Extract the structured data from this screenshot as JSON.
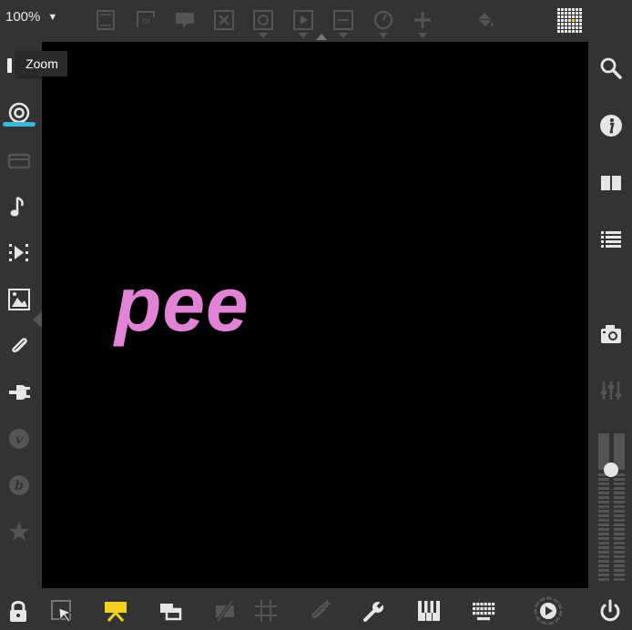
{
  "topbar": {
    "zoom_value": "100%",
    "zoom_arrow": "▼",
    "icons": [
      "frame-icon",
      "text-box-icon",
      "comment-icon",
      "close-box-icon",
      "record-box-icon",
      "play-box-icon",
      "minus-box-icon",
      "gauge-icon",
      "plus-icon",
      "paint-bucket-icon",
      "pixel-grid-icon"
    ]
  },
  "tooltip": {
    "label": "Zoom"
  },
  "stage": {
    "text": "pee",
    "text_color": "#e282d6",
    "background": "#000000"
  },
  "left_sidebar": {
    "icons": [
      "webcam-icon",
      "tray-icon",
      "music-note-icon",
      "skip-forward-icon",
      "image-icon",
      "paperclip-icon",
      "plug-icon",
      "vimeo-icon",
      "bandcamp-icon",
      "star-icon"
    ],
    "active_color": "#39b8d8"
  },
  "right_sidebar": {
    "icons": [
      "search-icon",
      "info-icon",
      "book-icon",
      "list-icon",
      "camera-icon",
      "sliders-icon"
    ],
    "volume_level": 0.8
  },
  "bottom_bar": {
    "icons": [
      "lock-icon",
      "select-cursor-icon",
      "presentation-icon",
      "windows-icon",
      "hide-icon",
      "grid-icon",
      "add-clip-icon",
      "wrench-icon",
      "piano-icon",
      "keyboard-icon",
      "play-circle-icon",
      "power-icon"
    ],
    "highlight_color": "#f2d21c"
  }
}
